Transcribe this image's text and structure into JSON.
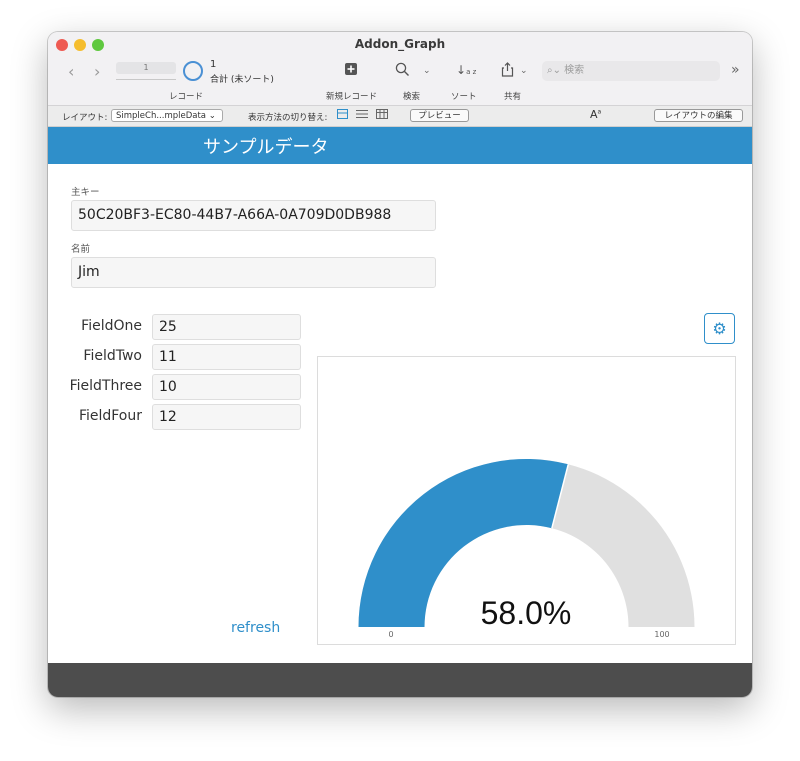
{
  "window": {
    "title": "Addon_Graph"
  },
  "toolbar": {
    "slider_value": "1",
    "record_number": "1",
    "record_total": "合計 (未ソート)",
    "records_label": "レコード",
    "new_record_label": "新規レコード",
    "find_label": "検索",
    "sort_label": "ソート",
    "share_label": "共有",
    "search_placeholder": "検索"
  },
  "layout_bar": {
    "layout_label": "レイアウト:",
    "layout_value": "SimpleCh...mpleData",
    "view_as_label": "表示方法の切り替え:",
    "preview_label": "プレビュー",
    "edit_layout_label": "レイアウトの編集"
  },
  "header": {
    "title": "サンプルデータ"
  },
  "fields": {
    "primary_key_label": "主キー",
    "primary_key_value": "50C20BF3-EC80-44B7-A66A-0A709D0DB988",
    "name_label": "名前",
    "name_value": "Jim"
  },
  "numeric_fields": [
    {
      "label": "FieldOne",
      "value": "25"
    },
    {
      "label": "FieldTwo",
      "value": "11"
    },
    {
      "label": "FieldThree",
      "value": "10"
    },
    {
      "label": "FieldFour",
      "value": "12"
    }
  ],
  "refresh_label": "refresh",
  "chart_data": {
    "type": "gauge",
    "value": 58.0,
    "display_value": "58.0%",
    "min": 0,
    "max": 100,
    "min_label": "0",
    "max_label": "100",
    "fill_color": "#2f8fca",
    "track_color": "#e0e0e0"
  },
  "colors": {
    "accent": "#2f8fca",
    "header_band": "#2f8fca",
    "footer": "#4d4d4d"
  }
}
